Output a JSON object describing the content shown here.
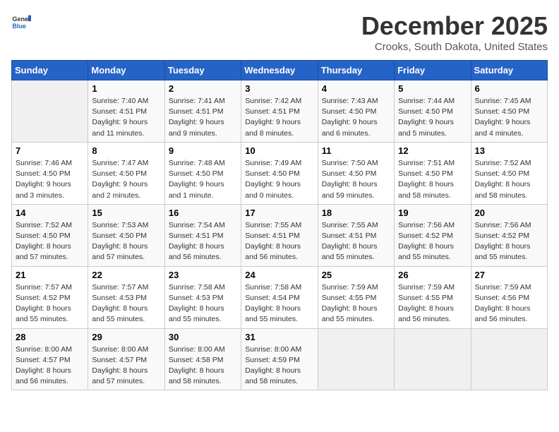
{
  "logo": {
    "line1": "General",
    "line2": "Blue"
  },
  "title": "December 2025",
  "subtitle": "Crooks, South Dakota, United States",
  "weekdays": [
    "Sunday",
    "Monday",
    "Tuesday",
    "Wednesday",
    "Thursday",
    "Friday",
    "Saturday"
  ],
  "weeks": [
    [
      {
        "day": "",
        "info": ""
      },
      {
        "day": "1",
        "info": "Sunrise: 7:40 AM\nSunset: 4:51 PM\nDaylight: 9 hours\nand 11 minutes."
      },
      {
        "day": "2",
        "info": "Sunrise: 7:41 AM\nSunset: 4:51 PM\nDaylight: 9 hours\nand 9 minutes."
      },
      {
        "day": "3",
        "info": "Sunrise: 7:42 AM\nSunset: 4:51 PM\nDaylight: 9 hours\nand 8 minutes."
      },
      {
        "day": "4",
        "info": "Sunrise: 7:43 AM\nSunset: 4:50 PM\nDaylight: 9 hours\nand 6 minutes."
      },
      {
        "day": "5",
        "info": "Sunrise: 7:44 AM\nSunset: 4:50 PM\nDaylight: 9 hours\nand 5 minutes."
      },
      {
        "day": "6",
        "info": "Sunrise: 7:45 AM\nSunset: 4:50 PM\nDaylight: 9 hours\nand 4 minutes."
      }
    ],
    [
      {
        "day": "7",
        "info": "Sunrise: 7:46 AM\nSunset: 4:50 PM\nDaylight: 9 hours\nand 3 minutes."
      },
      {
        "day": "8",
        "info": "Sunrise: 7:47 AM\nSunset: 4:50 PM\nDaylight: 9 hours\nand 2 minutes."
      },
      {
        "day": "9",
        "info": "Sunrise: 7:48 AM\nSunset: 4:50 PM\nDaylight: 9 hours\nand 1 minute."
      },
      {
        "day": "10",
        "info": "Sunrise: 7:49 AM\nSunset: 4:50 PM\nDaylight: 9 hours\nand 0 minutes."
      },
      {
        "day": "11",
        "info": "Sunrise: 7:50 AM\nSunset: 4:50 PM\nDaylight: 8 hours\nand 59 minutes."
      },
      {
        "day": "12",
        "info": "Sunrise: 7:51 AM\nSunset: 4:50 PM\nDaylight: 8 hours\nand 58 minutes."
      },
      {
        "day": "13",
        "info": "Sunrise: 7:52 AM\nSunset: 4:50 PM\nDaylight: 8 hours\nand 58 minutes."
      }
    ],
    [
      {
        "day": "14",
        "info": "Sunrise: 7:52 AM\nSunset: 4:50 PM\nDaylight: 8 hours\nand 57 minutes."
      },
      {
        "day": "15",
        "info": "Sunrise: 7:53 AM\nSunset: 4:50 PM\nDaylight: 8 hours\nand 57 minutes."
      },
      {
        "day": "16",
        "info": "Sunrise: 7:54 AM\nSunset: 4:51 PM\nDaylight: 8 hours\nand 56 minutes."
      },
      {
        "day": "17",
        "info": "Sunrise: 7:55 AM\nSunset: 4:51 PM\nDaylight: 8 hours\nand 56 minutes."
      },
      {
        "day": "18",
        "info": "Sunrise: 7:55 AM\nSunset: 4:51 PM\nDaylight: 8 hours\nand 55 minutes."
      },
      {
        "day": "19",
        "info": "Sunrise: 7:56 AM\nSunset: 4:52 PM\nDaylight: 8 hours\nand 55 minutes."
      },
      {
        "day": "20",
        "info": "Sunrise: 7:56 AM\nSunset: 4:52 PM\nDaylight: 8 hours\nand 55 minutes."
      }
    ],
    [
      {
        "day": "21",
        "info": "Sunrise: 7:57 AM\nSunset: 4:52 PM\nDaylight: 8 hours\nand 55 minutes."
      },
      {
        "day": "22",
        "info": "Sunrise: 7:57 AM\nSunset: 4:53 PM\nDaylight: 8 hours\nand 55 minutes."
      },
      {
        "day": "23",
        "info": "Sunrise: 7:58 AM\nSunset: 4:53 PM\nDaylight: 8 hours\nand 55 minutes."
      },
      {
        "day": "24",
        "info": "Sunrise: 7:58 AM\nSunset: 4:54 PM\nDaylight: 8 hours\nand 55 minutes."
      },
      {
        "day": "25",
        "info": "Sunrise: 7:59 AM\nSunset: 4:55 PM\nDaylight: 8 hours\nand 55 minutes."
      },
      {
        "day": "26",
        "info": "Sunrise: 7:59 AM\nSunset: 4:55 PM\nDaylight: 8 hours\nand 56 minutes."
      },
      {
        "day": "27",
        "info": "Sunrise: 7:59 AM\nSunset: 4:56 PM\nDaylight: 8 hours\nand 56 minutes."
      }
    ],
    [
      {
        "day": "28",
        "info": "Sunrise: 8:00 AM\nSunset: 4:57 PM\nDaylight: 8 hours\nand 56 minutes."
      },
      {
        "day": "29",
        "info": "Sunrise: 8:00 AM\nSunset: 4:57 PM\nDaylight: 8 hours\nand 57 minutes."
      },
      {
        "day": "30",
        "info": "Sunrise: 8:00 AM\nSunset: 4:58 PM\nDaylight: 8 hours\nand 58 minutes."
      },
      {
        "day": "31",
        "info": "Sunrise: 8:00 AM\nSunset: 4:59 PM\nDaylight: 8 hours\nand 58 minutes."
      },
      {
        "day": "",
        "info": ""
      },
      {
        "day": "",
        "info": ""
      },
      {
        "day": "",
        "info": ""
      }
    ]
  ]
}
